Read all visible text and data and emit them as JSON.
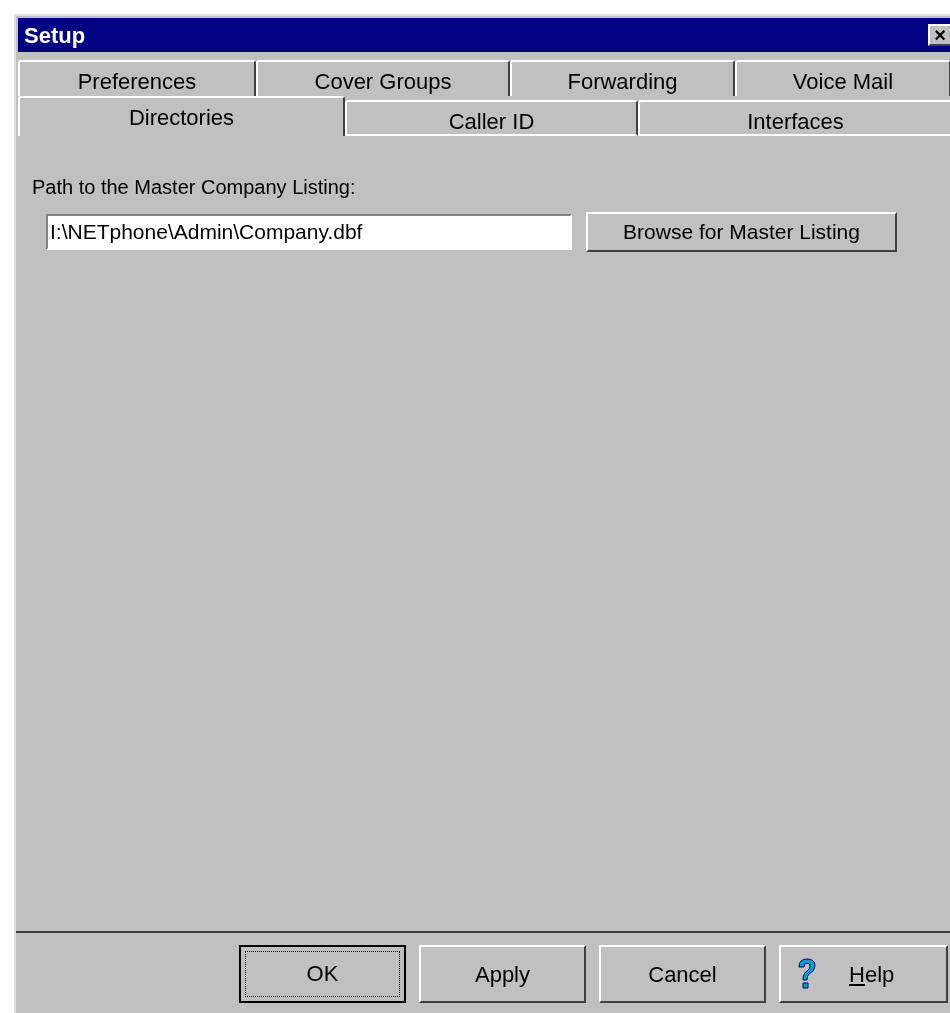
{
  "window": {
    "title": "Setup",
    "close": "×"
  },
  "tab_rows": [
    [
      {
        "label": "Preferences",
        "selected": false
      },
      {
        "label": "Cover Groups",
        "selected": false
      },
      {
        "label": "Forwarding",
        "selected": false
      },
      {
        "label": "Voice Mail",
        "selected": false
      }
    ],
    [
      {
        "label": "Directories",
        "selected": true
      },
      {
        "label": "Caller ID",
        "selected": false
      },
      {
        "label": "Interfaces",
        "selected": false
      }
    ]
  ],
  "panel": {
    "label": "Path to the Master Company Listing:",
    "path_value": "I:\\NETphone\\Admin\\Company.dbf",
    "browse_button": "Browse for Master Listing"
  },
  "buttons": [
    {
      "label": "OK",
      "kind": "default"
    },
    {
      "label": "Apply",
      "kind": "plain"
    },
    {
      "label": "Cancel",
      "kind": "plain"
    },
    {
      "label": "Help",
      "kind": "help"
    }
  ]
}
